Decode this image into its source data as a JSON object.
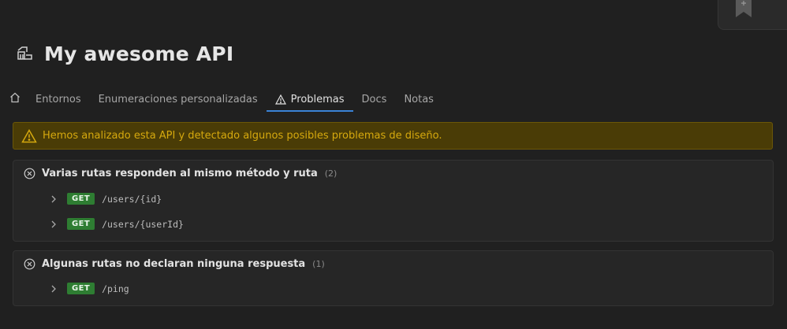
{
  "app": {
    "title": "My awesome API"
  },
  "tabs": [
    {
      "label": "Entornos"
    },
    {
      "label": "Enumeraciones personalizadas"
    },
    {
      "label": "Problemas"
    },
    {
      "label": "Docs"
    },
    {
      "label": "Notas"
    }
  ],
  "banner": {
    "text": "Hemos analizado esta API y detectado algunos posibles problemas de diseño."
  },
  "problems": [
    {
      "title": "Varias rutas responden al mismo método y ruta",
      "count": "(2)",
      "routes": [
        {
          "method": "GET",
          "path": "/users/{id}"
        },
        {
          "method": "GET",
          "path": "/users/{userId}"
        }
      ]
    },
    {
      "title": "Algunas rutas no declaran ninguna respuesta",
      "count": "(1)",
      "routes": [
        {
          "method": "GET",
          "path": "/ping"
        }
      ]
    }
  ],
  "colors": {
    "accent": "#3a82d6",
    "warning": "#d6a90e",
    "method_get": "#2e7d32"
  },
  "icons": [
    "plus-icon",
    "bookmark-icon",
    "api-icon",
    "home-icon",
    "warning-icon",
    "error-circle-icon",
    "chevron-right-icon"
  ]
}
